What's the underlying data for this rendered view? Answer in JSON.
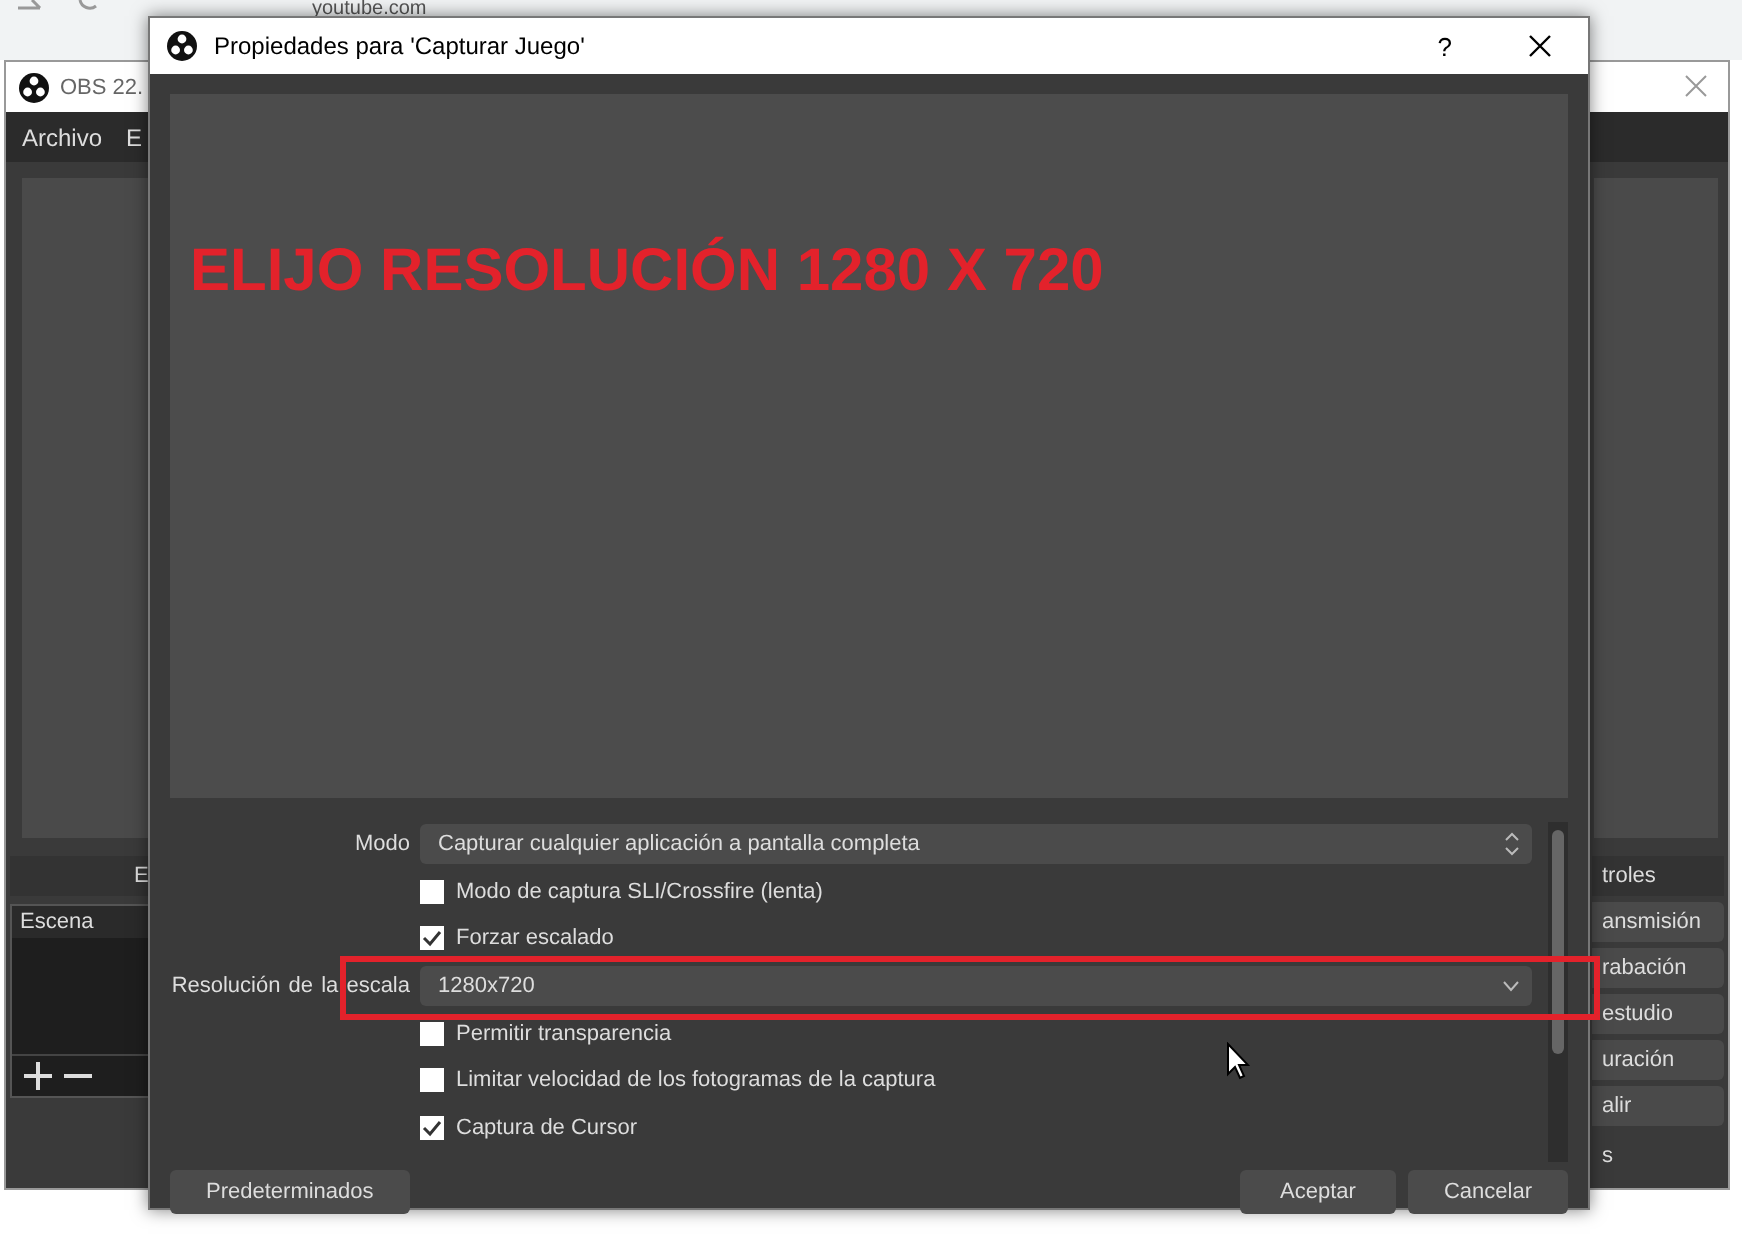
{
  "browser": {
    "address": "youtube.com"
  },
  "obs_window": {
    "title": "OBS 22.",
    "menu": [
      "Archivo",
      "E"
    ],
    "scenes_header": "E",
    "scenes_column": "Escena",
    "controls_header": "troles",
    "controls": [
      "ansmisión",
      "rabación",
      "estudio",
      "uración",
      "alir"
    ],
    "footer": "s"
  },
  "dialog": {
    "title": "Propiedades para 'Capturar Juego'",
    "help": "?",
    "preview_caption": "ELIJO RESOLUCIÓN 1280 X 720",
    "fields": [
      {
        "kind": "spin-select",
        "label": "Modo",
        "value": "Capturar cualquier aplicación a pantalla completa"
      },
      {
        "kind": "checkbox",
        "label": "Modo de captura SLI/Crossfire (lenta)",
        "checked": false
      },
      {
        "kind": "checkbox",
        "label": "Forzar escalado",
        "checked": true
      },
      {
        "kind": "select",
        "label": "Resolución de la escala",
        "value": "1280x720"
      },
      {
        "kind": "checkbox",
        "label": "Permitir transparencia",
        "checked": false
      },
      {
        "kind": "checkbox",
        "label": "Limitar velocidad de los fotogramas de la captura",
        "checked": false
      },
      {
        "kind": "checkbox",
        "label": "Captura de Cursor",
        "checked": true
      }
    ],
    "left_buttons": [
      "Predeterminados"
    ],
    "right_buttons": [
      "Aceptar",
      "Cancelar"
    ]
  }
}
